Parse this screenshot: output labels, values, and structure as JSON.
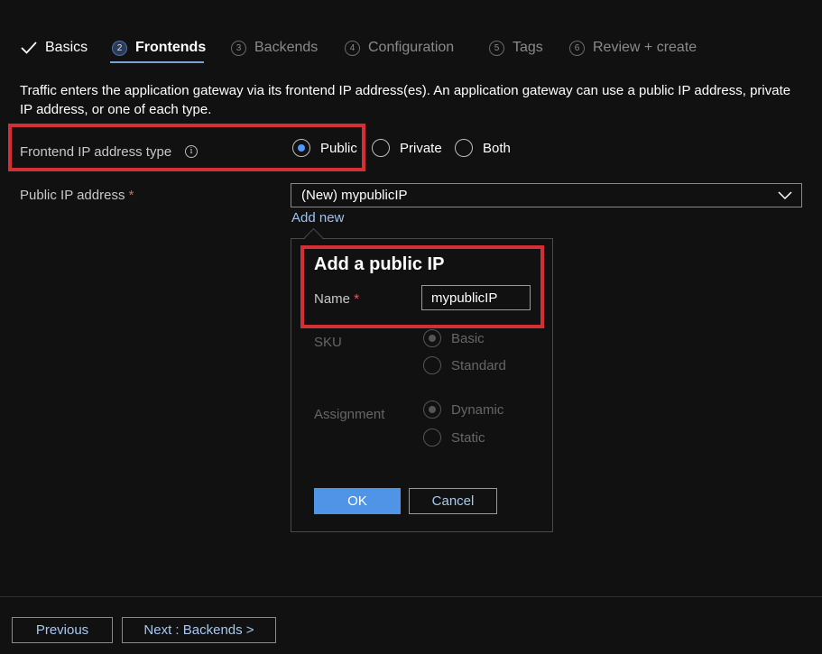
{
  "tabs": [
    {
      "num": "",
      "label": "Basics",
      "state": "done"
    },
    {
      "num": "2",
      "label": "Frontends",
      "state": "active"
    },
    {
      "num": "3",
      "label": "Backends",
      "state": "pending"
    },
    {
      "num": "4",
      "label": "Configuration",
      "state": "pending"
    },
    {
      "num": "5",
      "label": "Tags",
      "state": "pending"
    },
    {
      "num": "6",
      "label": "Review + create",
      "state": "pending"
    }
  ],
  "description": "Traffic enters the application gateway via its frontend IP address(es). An application gateway can use a public IP address, private IP address, or one of each type.",
  "frontend_ip_type": {
    "label": "Frontend IP address type",
    "options": [
      "Public",
      "Private",
      "Both"
    ],
    "selected": "Public"
  },
  "public_ip": {
    "label": "Public IP address",
    "required_mark": "*",
    "selected_value": "(New) mypublicIP",
    "add_new_link": "Add new"
  },
  "popup": {
    "title": "Add a public IP",
    "name_label": "Name",
    "required_mark": "*",
    "name_value": "mypublicIP",
    "sku_label": "SKU",
    "sku_options": [
      "Basic",
      "Standard"
    ],
    "sku_selected": "Basic",
    "assignment_label": "Assignment",
    "assignment_options": [
      "Dynamic",
      "Static"
    ],
    "assignment_selected": "Dynamic",
    "ok_label": "OK",
    "cancel_label": "Cancel"
  },
  "footer": {
    "previous_label": "Previous",
    "next_label": "Next : Backends >"
  },
  "colors": {
    "background": "#111111",
    "accent": "#4e9bff",
    "highlight_box": "#d32f35",
    "link": "#9cc3f0"
  }
}
